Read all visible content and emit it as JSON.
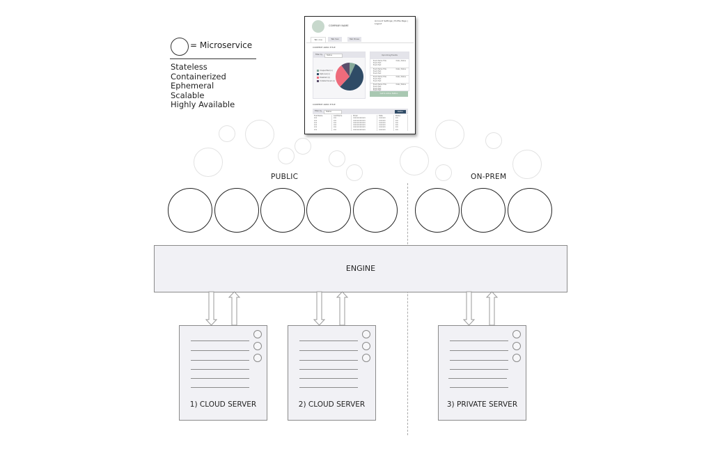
{
  "legend": {
    "symbol": "circle",
    "equals_label": "= Microservice",
    "properties": [
      "Stateless",
      "Containerized",
      "Ephemeral",
      "Scalable",
      "Highly Available"
    ]
  },
  "mock_app": {
    "company_name": "COMPANY NAME",
    "account_links": "Account Settings | Profile Page | Logout",
    "tabs": [
      "Tab one",
      "Tab two",
      "Tab three"
    ],
    "content_title_1": "CONTENT AREA TITLE",
    "filter_label": "Filter by",
    "filter_value": "Status",
    "pie_legend": [
      "Unspecified (n)",
      "Optional (n)",
      "Disabled (n)",
      "Undetermined (n)"
    ],
    "pie_colors": [
      "#86a99a",
      "#2f4b66",
      "#ee6b7b",
      "#5a4e6b"
    ],
    "pie_shares": [
      0.07,
      0.55,
      0.28,
      0.1
    ],
    "events_title": "Upcoming Events",
    "events": [
      {
        "text": "Event Name Title\nEvent Text\nEvent Text",
        "meta": "Date | Status"
      },
      {
        "text": "Event Name Title\nEvent Text\nEvent Text",
        "meta": "Date | Status"
      },
      {
        "text": "Event Name Title\nEvent Text\nEvent Text",
        "meta": "Date | Status"
      },
      {
        "text": "Event Name Title\nEvent Text\nEvent Text\nEvent Text",
        "meta": "Date | Status"
      }
    ],
    "cta_label": "Call to Action Button",
    "content_title_2": "CONTENT AREA TITLE",
    "table_button": "Button",
    "table_headers": [
      "First Name",
      "Last Name",
      "Email",
      "Date",
      "Status"
    ],
    "table_rows": [
      [
        "xxx",
        "xxx",
        "xxxxxxxxxxxxx",
        "xxxxxxx",
        "xxx"
      ],
      [
        "xxx",
        "xxx",
        "xxxxxxxxxxxxx",
        "xxxxxxx",
        "xxx"
      ],
      [
        "xxx",
        "xxx",
        "xxxxxxxxxxxxx",
        "xxxxxxx",
        "xxx"
      ],
      [
        "xxx",
        "xxx",
        "xxxxxxxxxxxxx",
        "xxxxxxx",
        "xxx"
      ],
      [
        "xxx",
        "xxx",
        "xxxxxxxxxxxxx",
        "xxxxxxx",
        "xxx"
      ],
      [
        "xxx",
        "xxx",
        "xxxxxxxxxxxxx",
        "xxxxxxx",
        "xxx"
      ]
    ]
  },
  "zones": {
    "public_label": "PUBLIC",
    "onprem_label": "ON-PREM",
    "public_microservices": 5,
    "onprem_microservices": 3
  },
  "engine": {
    "label": "ENGINE"
  },
  "servers": [
    {
      "label": "1) CLOUD SERVER",
      "zone": "public"
    },
    {
      "label": "2) CLOUD SERVER",
      "zone": "public"
    },
    {
      "label": "3) PRIVATE SERVER",
      "zone": "on-prem"
    }
  ],
  "colors": {
    "box_fill": "#f1f1f5",
    "box_border": "#8a8a8a",
    "outline": "#222222"
  }
}
